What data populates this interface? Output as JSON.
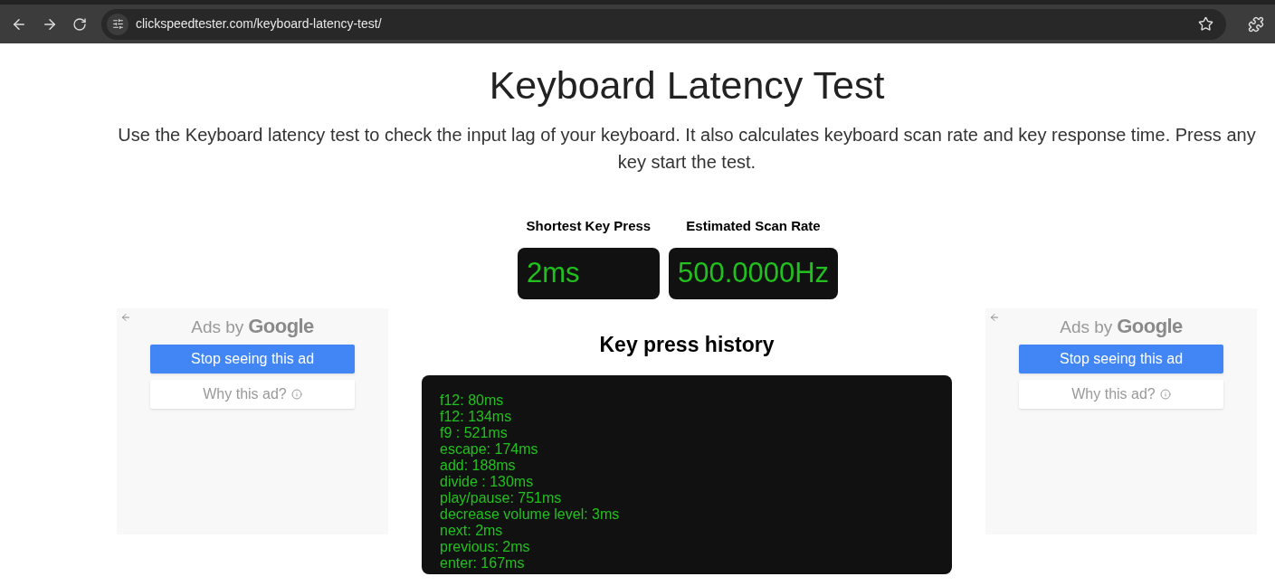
{
  "browser": {
    "url": "clickspeedtester.com/keyboard-latency-test/"
  },
  "page": {
    "title": "Keyboard Latency Test",
    "description": "Use the Keyboard latency test to check the input lag of your keyboard. It also calculates keyboard scan rate and key response time. Press any key start the test."
  },
  "stats": [
    {
      "label": "Shortest Key Press",
      "value": "2ms"
    },
    {
      "label": "Estimated Scan Rate",
      "value": "500.0000Hz"
    }
  ],
  "ads": [
    {
      "ads_by": "Ads by",
      "brand": "Google",
      "stop_button": "Stop seeing this ad",
      "why_button": "Why this ad?"
    },
    {
      "ads_by": "Ads by",
      "brand": "Google",
      "stop_button": "Stop seeing this ad",
      "why_button": "Why this ad?"
    }
  ],
  "history": {
    "title": "Key press history",
    "entries": [
      "f12: 80ms",
      "f12: 134ms",
      "f9 : 521ms",
      "escape: 174ms",
      "add: 188ms",
      "divide : 130ms",
      "play/pause: 751ms",
      "decrease volume level: 3ms",
      "next: 2ms",
      "previous: 2ms",
      "enter: 167ms"
    ]
  }
}
